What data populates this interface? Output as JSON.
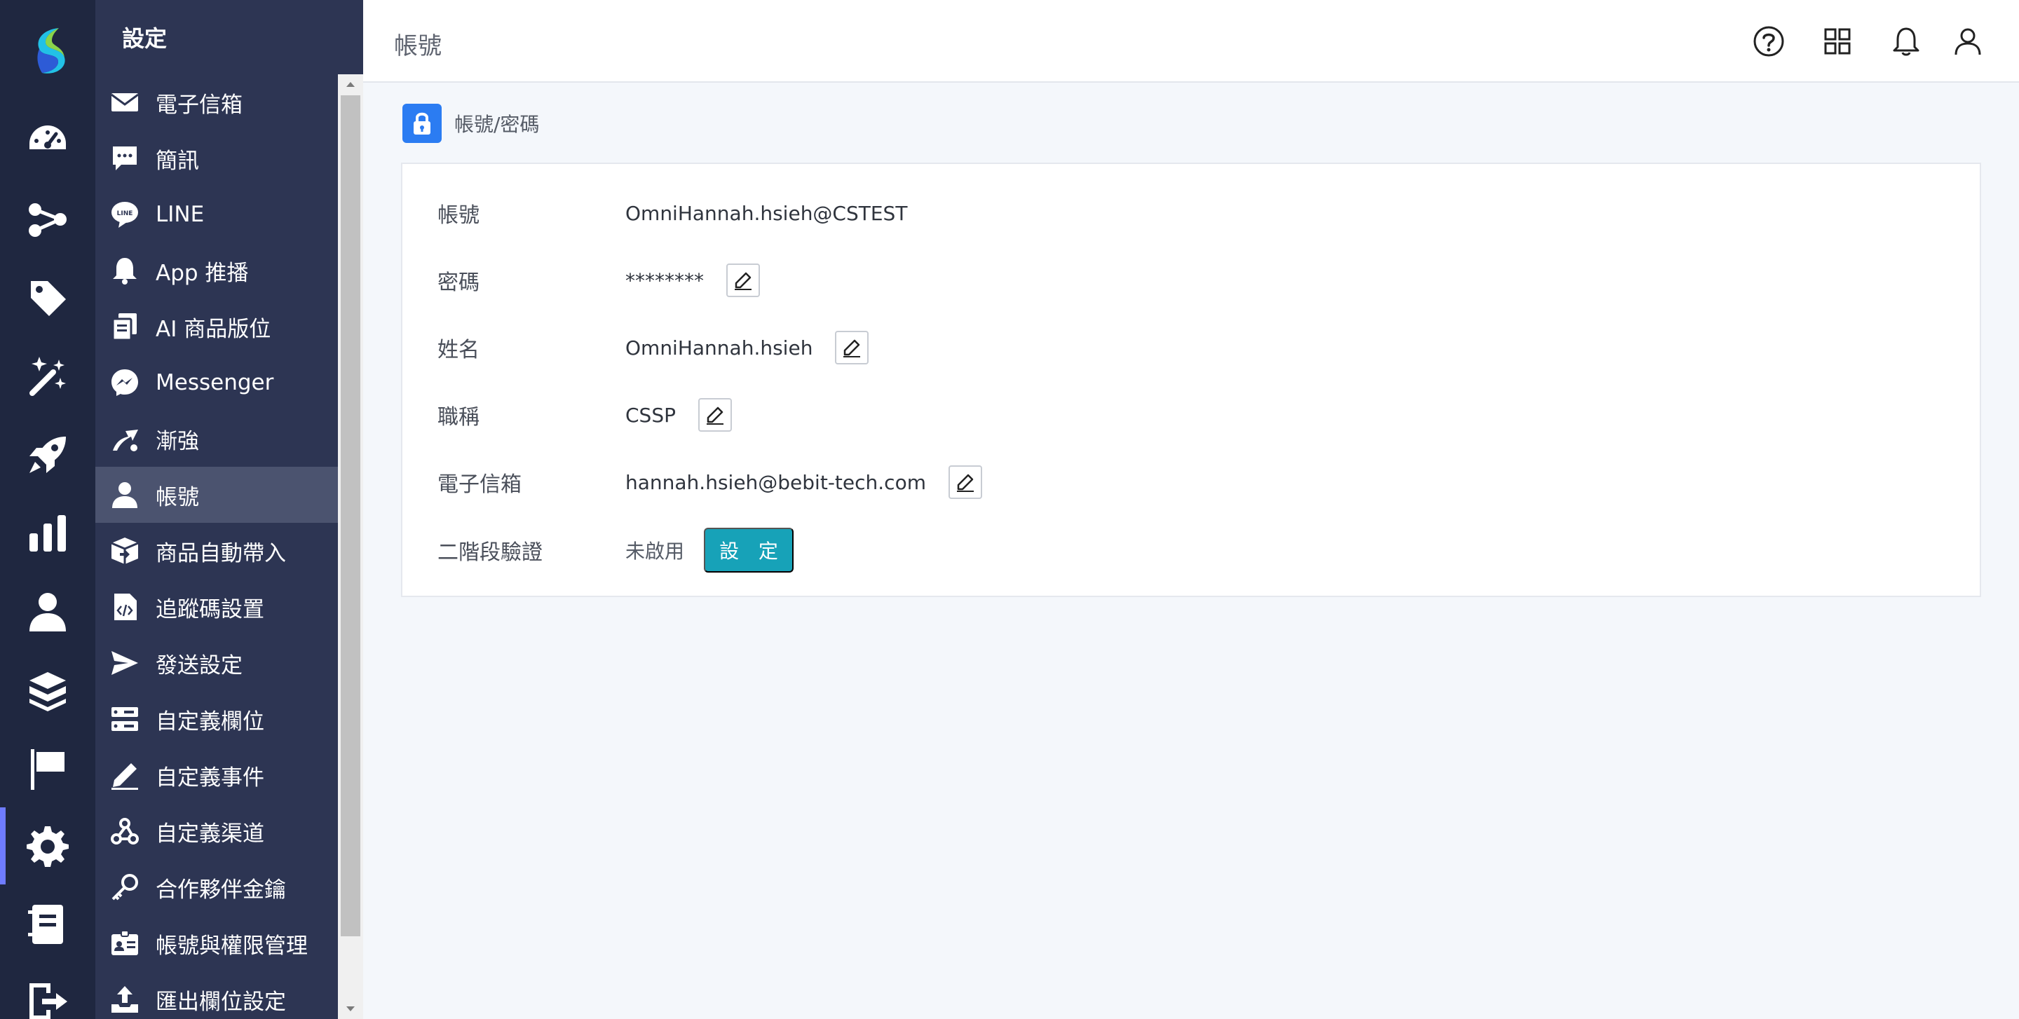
{
  "sidebar": {
    "title": "設定",
    "items": [
      {
        "label": "電子信箱",
        "icon": "envelope-icon"
      },
      {
        "label": "簡訊",
        "icon": "chat-bubble-icon"
      },
      {
        "label": "LINE",
        "icon": "line-icon"
      },
      {
        "label": "App 推播",
        "icon": "bell-icon"
      },
      {
        "label": "AI 商品版位",
        "icon": "copy-icon"
      },
      {
        "label": "Messenger",
        "icon": "messenger-icon"
      },
      {
        "label": "漸強",
        "icon": "crescendo-icon"
      },
      {
        "label": "帳號",
        "icon": "user-icon",
        "active": true
      },
      {
        "label": "商品自動帶入",
        "icon": "box-icon"
      },
      {
        "label": "追蹤碼設置",
        "icon": "code-file-icon"
      },
      {
        "label": "發送設定",
        "icon": "paper-plane-icon"
      },
      {
        "label": "自定義欄位",
        "icon": "server-icon"
      },
      {
        "label": "自定義事件",
        "icon": "pen-icon"
      },
      {
        "label": "自定義渠道",
        "icon": "webhook-icon"
      },
      {
        "label": "合作夥伴金鑰",
        "icon": "key-icon"
      },
      {
        "label": "帳號與權限管理",
        "icon": "id-card-icon"
      },
      {
        "label": "匯出欄位設定",
        "icon": "upload-icon"
      }
    ]
  },
  "rail": {
    "items": [
      "dashboard-icon",
      "share-nodes-icon",
      "tag-icon",
      "magic-wand-icon",
      "rocket-icon",
      "bar-chart-icon",
      "person-icon",
      "boxes-icon",
      "flag-icon",
      "gear-icon",
      "notebook-icon",
      "exit-icon"
    ],
    "active": "gear-icon"
  },
  "header": {
    "title": "帳號",
    "icons": [
      "help-icon",
      "apps-grid-icon",
      "notification-bell-icon",
      "profile-icon"
    ]
  },
  "section": {
    "title": "帳號/密碼"
  },
  "account": {
    "rows": [
      {
        "label": "帳號",
        "value": "OmniHannah.hsieh@CSTEST",
        "editable": false
      },
      {
        "label": "密碼",
        "value": "********",
        "editable": true
      },
      {
        "label": "姓名",
        "value": "OmniHannah.hsieh",
        "editable": true
      },
      {
        "label": "職稱",
        "value": "CSSP",
        "editable": true
      },
      {
        "label": "電子信箱",
        "value": "hannah.hsieh@bebit-tech.com",
        "editable": true
      }
    ],
    "two_factor": {
      "label": "二階段驗證",
      "status": "未啟用",
      "button_label": "設 定"
    }
  },
  "colors": {
    "rail_bg": "#1f2740",
    "menu_bg": "#2d3553",
    "menu_active": "#4b536f",
    "accent_blue": "#2b7cf2",
    "button_teal": "#17a2b8"
  }
}
